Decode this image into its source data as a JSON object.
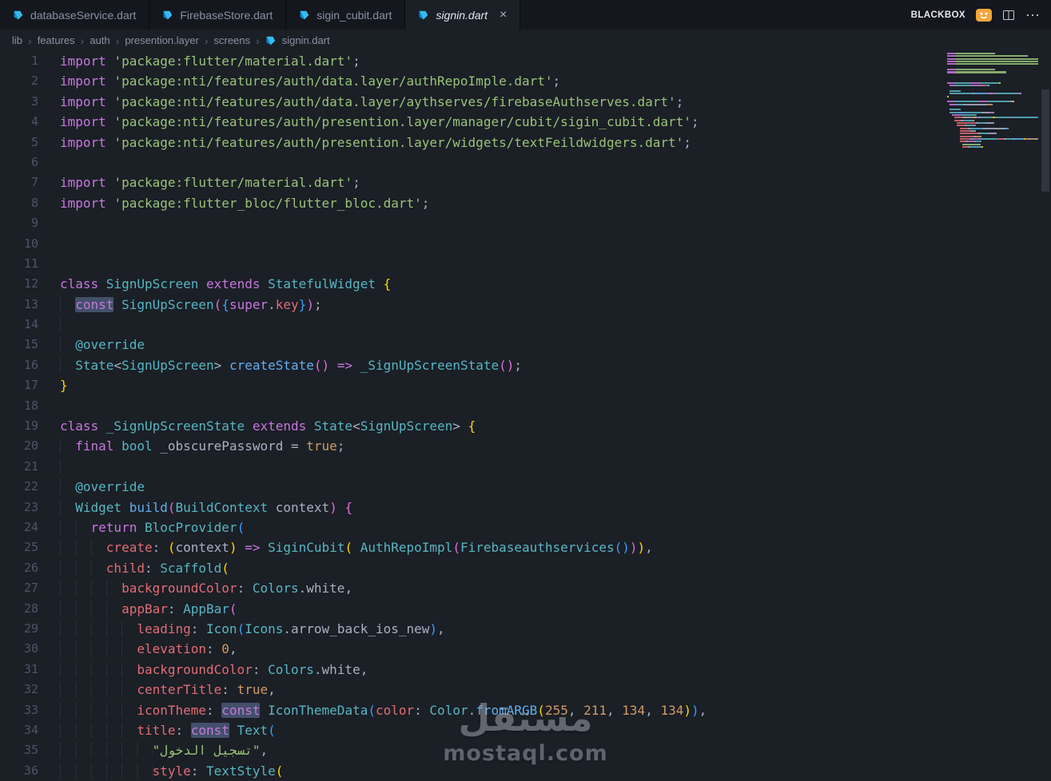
{
  "colors": {
    "bg": "#1b1f26",
    "tabbar-bg": "#14171d",
    "text": "#a8b1c2",
    "keyword": "#c678dd",
    "string": "#98c379",
    "type": "#56b6c2",
    "func": "#61afef",
    "property": "#e06c75",
    "number": "#d19a66",
    "annotation": "#56b6c2",
    "line-number": "#4c5568",
    "bracket1": "#ffd700",
    "bracket2": "#da70d6",
    "bracket3": "#3a9df8",
    "highlight": "#43506b",
    "orange": "#f2a63c",
    "crumb": "#8a92a3",
    "tab-text": "#8791a3",
    "tab-active-text": "#e2e6ee"
  },
  "tabs": {
    "items": [
      {
        "label": "databaseService.dart",
        "active": false
      },
      {
        "label": "FirebaseStore.dart",
        "active": false
      },
      {
        "label": "sigin_cubit.dart",
        "active": false
      },
      {
        "label": "signin.dart",
        "active": true,
        "close": "×"
      }
    ],
    "actions": {
      "blackbox_label": "BLACKBOX",
      "more_icon": "⋯"
    }
  },
  "breadcrumb": {
    "separator": "›",
    "items": [
      "lib",
      "features",
      "auth",
      "presention.layer",
      "screens",
      "signin.dart"
    ]
  },
  "watermark": {
    "title": "مستقل",
    "subtitle": "mostaql.com"
  },
  "editor": {
    "lines": [
      {
        "n": 1,
        "ws": 0,
        "segs": [
          [
            "import ",
            "kw"
          ],
          [
            "'package:flutter/material.dart'",
            "str"
          ],
          [
            ";",
            "d"
          ]
        ]
      },
      {
        "n": 2,
        "ws": 0,
        "segs": [
          [
            "import ",
            "kw"
          ],
          [
            "'package:nti/features/auth/data.layer/authRepoImple.dart'",
            "str"
          ],
          [
            ";",
            "d"
          ]
        ]
      },
      {
        "n": 3,
        "ws": 0,
        "segs": [
          [
            "import ",
            "kw"
          ],
          [
            "'package:nti/features/auth/data.layer/aythserves/firebaseAuthserves.dart'",
            "str"
          ],
          [
            ";",
            "d"
          ]
        ]
      },
      {
        "n": 4,
        "ws": 0,
        "segs": [
          [
            "import ",
            "kw"
          ],
          [
            "'package:nti/features/auth/presention.layer/manager/cubit/sigin_cubit.dart'",
            "str"
          ],
          [
            ";",
            "d"
          ]
        ]
      },
      {
        "n": 5,
        "ws": 0,
        "segs": [
          [
            "import ",
            "kw"
          ],
          [
            "'package:nti/features/auth/presention.layer/widgets/textFeildwidgers.dart'",
            "str"
          ],
          [
            ";",
            "d"
          ]
        ]
      },
      {
        "n": 6,
        "ws": 0,
        "segs": []
      },
      {
        "n": 7,
        "ws": 0,
        "segs": [
          [
            "import ",
            "kw"
          ],
          [
            "'package:flutter/material.dart'",
            "str"
          ],
          [
            ";",
            "d"
          ]
        ]
      },
      {
        "n": 8,
        "ws": 0,
        "segs": [
          [
            "import ",
            "kw"
          ],
          [
            "'package:flutter_bloc/flutter_bloc.dart'",
            "str"
          ],
          [
            ";",
            "d"
          ]
        ]
      },
      {
        "n": 9,
        "ws": 0,
        "segs": []
      },
      {
        "n": 10,
        "ws": 0,
        "segs": []
      },
      {
        "n": 11,
        "ws": 0,
        "segs": []
      },
      {
        "n": 12,
        "ws": 0,
        "segs": [
          [
            "class ",
            "kw"
          ],
          [
            "SignUpScreen ",
            "typ"
          ],
          [
            "extends ",
            "kw"
          ],
          [
            "StatefulWidget ",
            "typ"
          ],
          [
            "{",
            "b1"
          ]
        ]
      },
      {
        "n": 13,
        "ws": 2,
        "segs": [
          [
            "const",
            "kw hl"
          ],
          [
            " ",
            "d"
          ],
          [
            "SignUpScreen",
            "typ"
          ],
          [
            "(",
            "b2"
          ],
          [
            "{",
            "b3"
          ],
          [
            "super",
            "kw"
          ],
          [
            ".",
            "d"
          ],
          [
            "key",
            "prop"
          ],
          [
            "}",
            "b3"
          ],
          [
            ")",
            "b2"
          ],
          [
            ";",
            "d"
          ]
        ]
      },
      {
        "n": 14,
        "ws": 2,
        "segs": []
      },
      {
        "n": 15,
        "ws": 2,
        "segs": [
          [
            "@override",
            "ann"
          ]
        ]
      },
      {
        "n": 16,
        "ws": 2,
        "segs": [
          [
            "State",
            "typ"
          ],
          [
            "<",
            "d"
          ],
          [
            "SignUpScreen",
            "typ"
          ],
          [
            "> ",
            "d"
          ],
          [
            "createState",
            "fn"
          ],
          [
            "(",
            "b2"
          ],
          [
            ")",
            "b2"
          ],
          [
            " ",
            "d"
          ],
          [
            "=>",
            "kw"
          ],
          [
            " ",
            "d"
          ],
          [
            "_SignUpScreenState",
            "typ"
          ],
          [
            "(",
            "b2"
          ],
          [
            ")",
            "b2"
          ],
          [
            ";",
            "d"
          ]
        ]
      },
      {
        "n": 17,
        "ws": 0,
        "segs": [
          [
            "}",
            "b1"
          ]
        ]
      },
      {
        "n": 18,
        "ws": 0,
        "segs": []
      },
      {
        "n": 19,
        "ws": 0,
        "segs": [
          [
            "class ",
            "kw"
          ],
          [
            "_SignUpScreenState ",
            "typ"
          ],
          [
            "extends ",
            "kw"
          ],
          [
            "State",
            "typ"
          ],
          [
            "<",
            "d"
          ],
          [
            "SignUpScreen",
            "typ"
          ],
          [
            "> ",
            "d"
          ],
          [
            "{",
            "b1"
          ]
        ]
      },
      {
        "n": 20,
        "ws": 2,
        "segs": [
          [
            "final ",
            "kw"
          ],
          [
            "bool ",
            "typ"
          ],
          [
            "_obscurePassword ",
            "d"
          ],
          [
            "= ",
            "d"
          ],
          [
            "true",
            "num"
          ],
          [
            ";",
            "d"
          ]
        ]
      },
      {
        "n": 21,
        "ws": 2,
        "segs": []
      },
      {
        "n": 22,
        "ws": 2,
        "segs": [
          [
            "@override",
            "ann"
          ]
        ]
      },
      {
        "n": 23,
        "ws": 2,
        "segs": [
          [
            "Widget ",
            "typ"
          ],
          [
            "build",
            "fn"
          ],
          [
            "(",
            "b2"
          ],
          [
            "BuildContext ",
            "typ"
          ],
          [
            "context",
            "d"
          ],
          [
            ")",
            "b2"
          ],
          [
            " ",
            "d"
          ],
          [
            "{",
            "b2"
          ]
        ]
      },
      {
        "n": 24,
        "ws": 4,
        "segs": [
          [
            "return ",
            "kw"
          ],
          [
            "BlocProvider",
            "typ"
          ],
          [
            "(",
            "b3"
          ]
        ]
      },
      {
        "n": 25,
        "ws": 6,
        "segs": [
          [
            "create",
            "prop"
          ],
          [
            ": ",
            "d"
          ],
          [
            "(",
            "b1"
          ],
          [
            "context",
            "d"
          ],
          [
            ")",
            "b1"
          ],
          [
            " ",
            "d"
          ],
          [
            "=>",
            "kw"
          ],
          [
            " ",
            "d"
          ],
          [
            "SiginCubit",
            "typ"
          ],
          [
            "( ",
            "b1"
          ],
          [
            "AuthRepoImpl",
            "typ"
          ],
          [
            "(",
            "b2"
          ],
          [
            "Firebaseauthservices",
            "typ"
          ],
          [
            "(",
            "b3"
          ],
          [
            ")",
            "b3"
          ],
          [
            ")",
            "b2"
          ],
          [
            ")",
            "b1"
          ],
          [
            ",",
            "d"
          ]
        ]
      },
      {
        "n": 26,
        "ws": 6,
        "segs": [
          [
            "child",
            "prop"
          ],
          [
            ": ",
            "d"
          ],
          [
            "Scaffold",
            "typ"
          ],
          [
            "(",
            "b1"
          ]
        ]
      },
      {
        "n": 27,
        "ws": 8,
        "segs": [
          [
            "backgroundColor",
            "prop"
          ],
          [
            ": ",
            "d"
          ],
          [
            "Colors",
            "typ"
          ],
          [
            ".",
            "d"
          ],
          [
            "white",
            "d"
          ],
          [
            ",",
            "d"
          ]
        ]
      },
      {
        "n": 28,
        "ws": 8,
        "segs": [
          [
            "appBar",
            "prop"
          ],
          [
            ": ",
            "d"
          ],
          [
            "AppBar",
            "typ"
          ],
          [
            "(",
            "b2"
          ]
        ]
      },
      {
        "n": 29,
        "ws": 10,
        "segs": [
          [
            "leading",
            "prop"
          ],
          [
            ": ",
            "d"
          ],
          [
            "Icon",
            "typ"
          ],
          [
            "(",
            "b3"
          ],
          [
            "Icons",
            "typ"
          ],
          [
            ".",
            "d"
          ],
          [
            "arrow_back_ios_new",
            "d"
          ],
          [
            ")",
            "b3"
          ],
          [
            ",",
            "d"
          ]
        ]
      },
      {
        "n": 30,
        "ws": 10,
        "segs": [
          [
            "elevation",
            "prop"
          ],
          [
            ": ",
            "d"
          ],
          [
            "0",
            "num"
          ],
          [
            ",",
            "d"
          ]
        ]
      },
      {
        "n": 31,
        "ws": 10,
        "segs": [
          [
            "backgroundColor",
            "prop"
          ],
          [
            ": ",
            "d"
          ],
          [
            "Colors",
            "typ"
          ],
          [
            ".",
            "d"
          ],
          [
            "white",
            "d"
          ],
          [
            ",",
            "d"
          ]
        ]
      },
      {
        "n": 32,
        "ws": 10,
        "segs": [
          [
            "centerTitle",
            "prop"
          ],
          [
            ": ",
            "d"
          ],
          [
            "true",
            "num"
          ],
          [
            ",",
            "d"
          ]
        ]
      },
      {
        "n": 33,
        "ws": 10,
        "segs": [
          [
            "iconTheme",
            "prop"
          ],
          [
            ": ",
            "d"
          ],
          [
            "const",
            "kw hl"
          ],
          [
            " ",
            "d"
          ],
          [
            "IconThemeData",
            "typ"
          ],
          [
            "(",
            "b3"
          ],
          [
            "color",
            "prop"
          ],
          [
            ": ",
            "d"
          ],
          [
            "Color",
            "typ"
          ],
          [
            ".",
            "d"
          ],
          [
            "fromARGB",
            "fn"
          ],
          [
            "(",
            "b1"
          ],
          [
            "255",
            "num"
          ],
          [
            ", ",
            "d"
          ],
          [
            "211",
            "num"
          ],
          [
            ", ",
            "d"
          ],
          [
            "134",
            "num"
          ],
          [
            ", ",
            "d"
          ],
          [
            "134",
            "num"
          ],
          [
            ")",
            "b1"
          ],
          [
            ")",
            "b3"
          ],
          [
            ",",
            "d"
          ]
        ]
      },
      {
        "n": 34,
        "ws": 10,
        "segs": [
          [
            "title",
            "prop"
          ],
          [
            ": ",
            "d"
          ],
          [
            "const",
            "kw hl"
          ],
          [
            " ",
            "d"
          ],
          [
            "Text",
            "typ"
          ],
          [
            "(",
            "b3"
          ]
        ]
      },
      {
        "n": 35,
        "ws": 12,
        "segs": [
          [
            "\"تسجيل الدخول\"",
            "str"
          ],
          [
            ",",
            "d"
          ]
        ]
      },
      {
        "n": 36,
        "ws": 12,
        "segs": [
          [
            "style",
            "prop"
          ],
          [
            ": ",
            "d"
          ],
          [
            "TextStyle",
            "typ"
          ],
          [
            "(",
            "b1"
          ]
        ]
      }
    ]
  }
}
